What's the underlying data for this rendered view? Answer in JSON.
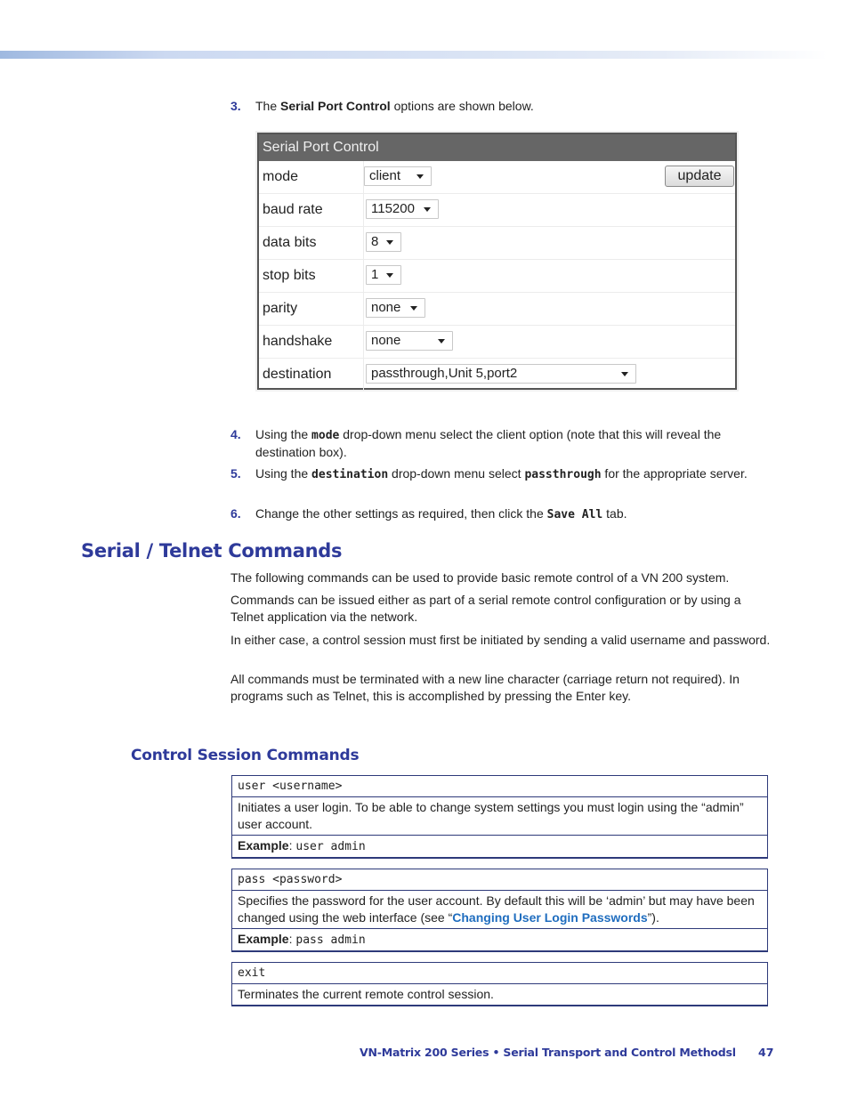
{
  "header_bar": {
    "colors": {
      "start": "#9fb9e0",
      "end": "#ffffff"
    }
  },
  "steps": [
    {
      "num": "3.",
      "parts": [
        {
          "t": "The ",
          "s": "plain"
        },
        {
          "t": "Serial Port Control",
          "s": "bold"
        },
        {
          "t": " options are shown below.",
          "s": "plain"
        }
      ]
    },
    {
      "num": "4.",
      "parts": [
        {
          "t": "Using the ",
          "s": "plain"
        },
        {
          "t": "mode",
          "s": "mono"
        },
        {
          "t": " drop-down menu select the client option (note that this will reveal the destination box).",
          "s": "plain"
        }
      ]
    },
    {
      "num": "5.",
      "parts": [
        {
          "t": "Using the ",
          "s": "plain"
        },
        {
          "t": "destination",
          "s": "mono"
        },
        {
          "t": " drop-down menu select ",
          "s": "plain"
        },
        {
          "t": "passthrough",
          "s": "mono"
        },
        {
          "t": " for the appropriate server.",
          "s": "plain"
        }
      ]
    },
    {
      "num": "6.",
      "parts": [
        {
          "t": "Change the other settings as required, then click the ",
          "s": "plain"
        },
        {
          "t": "Save All",
          "s": "mono"
        },
        {
          "t": " tab.",
          "s": "plain"
        }
      ]
    }
  ],
  "serial_panel": {
    "title": "Serial Port Control",
    "update_label": "update",
    "rows": [
      {
        "label": "mode",
        "value": "client"
      },
      {
        "label": "baud rate",
        "value": "115200"
      },
      {
        "label": "data bits",
        "value": "8"
      },
      {
        "label": "stop bits",
        "value": "1"
      },
      {
        "label": "parity",
        "value": "none"
      },
      {
        "label": "handshake",
        "value": "none"
      },
      {
        "label": "destination",
        "value": "passthrough,Unit 5,port2"
      }
    ]
  },
  "section": {
    "title": "Serial / Telnet Commands",
    "paragraphs": [
      "The following commands can be used to provide basic remote control of a VN 200 system.",
      "Commands can be issued either as part of a serial remote control configuration or by using a Telnet application via the network.",
      "In either case, a control session must first be initiated by sending a valid username and password.",
      "All commands must be terminated with a new line character (carriage return not required). In programs such as Telnet, this is accomplished by pressing the Enter key."
    ]
  },
  "subsection": {
    "title": "Control Session Commands",
    "commands": [
      {
        "syntax": "user <username>",
        "description": "Initiates a user login. To be able to change system settings you must login using the “admin” user account.",
        "example_label": "Example",
        "example": "user admin"
      },
      {
        "syntax": "pass <password>",
        "description_pre": "Specifies the password for the user account. By default this will be ‘admin’ but may have been changed using the web interface (see “",
        "description_link": "Changing User Login Passwords",
        "description_post": "”).",
        "example_label": "Example",
        "example": "pass admin"
      },
      {
        "syntax": "exit",
        "description": "Terminates the current remote control session."
      }
    ]
  },
  "footer": {
    "text": "VN-Matrix 200 Series  • Serial Transport and Control Methodsl",
    "page": "47"
  },
  "colors": {
    "heading": "#2e3a9a",
    "link": "#1f6dbf",
    "panel_header": "#666666"
  }
}
